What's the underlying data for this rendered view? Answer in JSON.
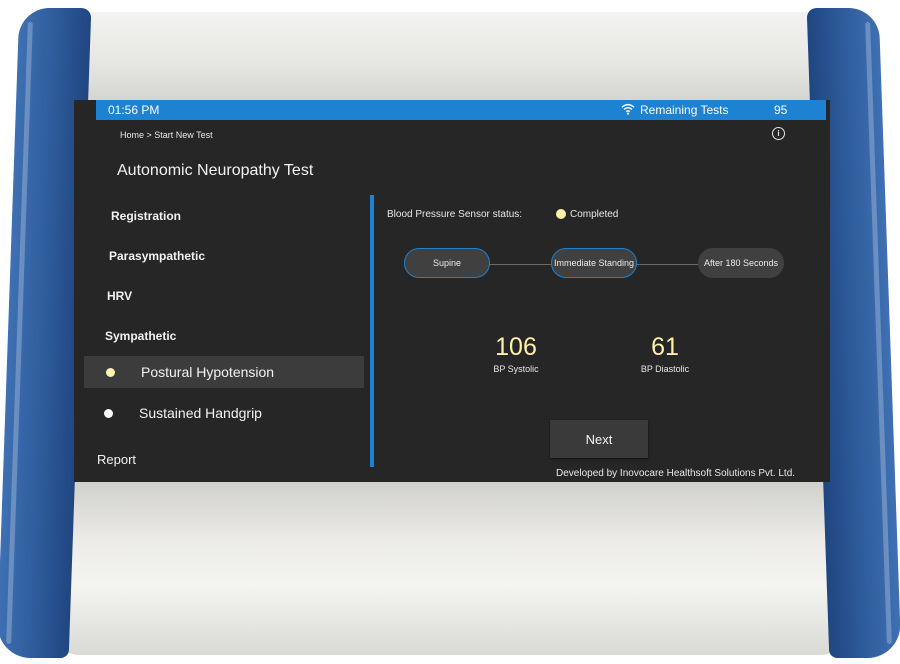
{
  "statusbar": {
    "time": "01:56 PM",
    "wifi_icon": "wifi-icon",
    "remaining_label": "Remaining Tests",
    "remaining_count": "95"
  },
  "header": {
    "breadcrumb": "Home > Start New Test",
    "info_icon": "info-icon",
    "title": "Autonomic Neuropathy Test"
  },
  "nav": {
    "registration": "Registration",
    "parasympathetic": "Parasympathetic",
    "hrv": "HRV",
    "sympathetic": "Sympathetic",
    "sub_items": [
      {
        "label": "Postural Hypotension",
        "dot_color": "#fff3b0"
      },
      {
        "label": "Sustained Handgrip",
        "dot_color": "#ffffff"
      }
    ],
    "report": "Report"
  },
  "main": {
    "sensor_label": "Blood Pressure Sensor status:",
    "sensor_value": "Completed",
    "sensor_dot_color": "#fff1a8",
    "steps": [
      "Supine",
      "Immediate Standing",
      "After 180 Seconds"
    ],
    "readings": [
      {
        "value": "106",
        "caption": "BP Systolic"
      },
      {
        "value": "61",
        "caption": "BP Diastolic"
      }
    ],
    "next_label": "Next",
    "footer": "Developed by Inovocare Healthsoft Solutions Pvt. Ltd."
  },
  "colors": {
    "accent": "#1d82d1",
    "screen_bg": "#262626",
    "reading": "#fff1a8",
    "device_blue": "#2d5a99"
  }
}
